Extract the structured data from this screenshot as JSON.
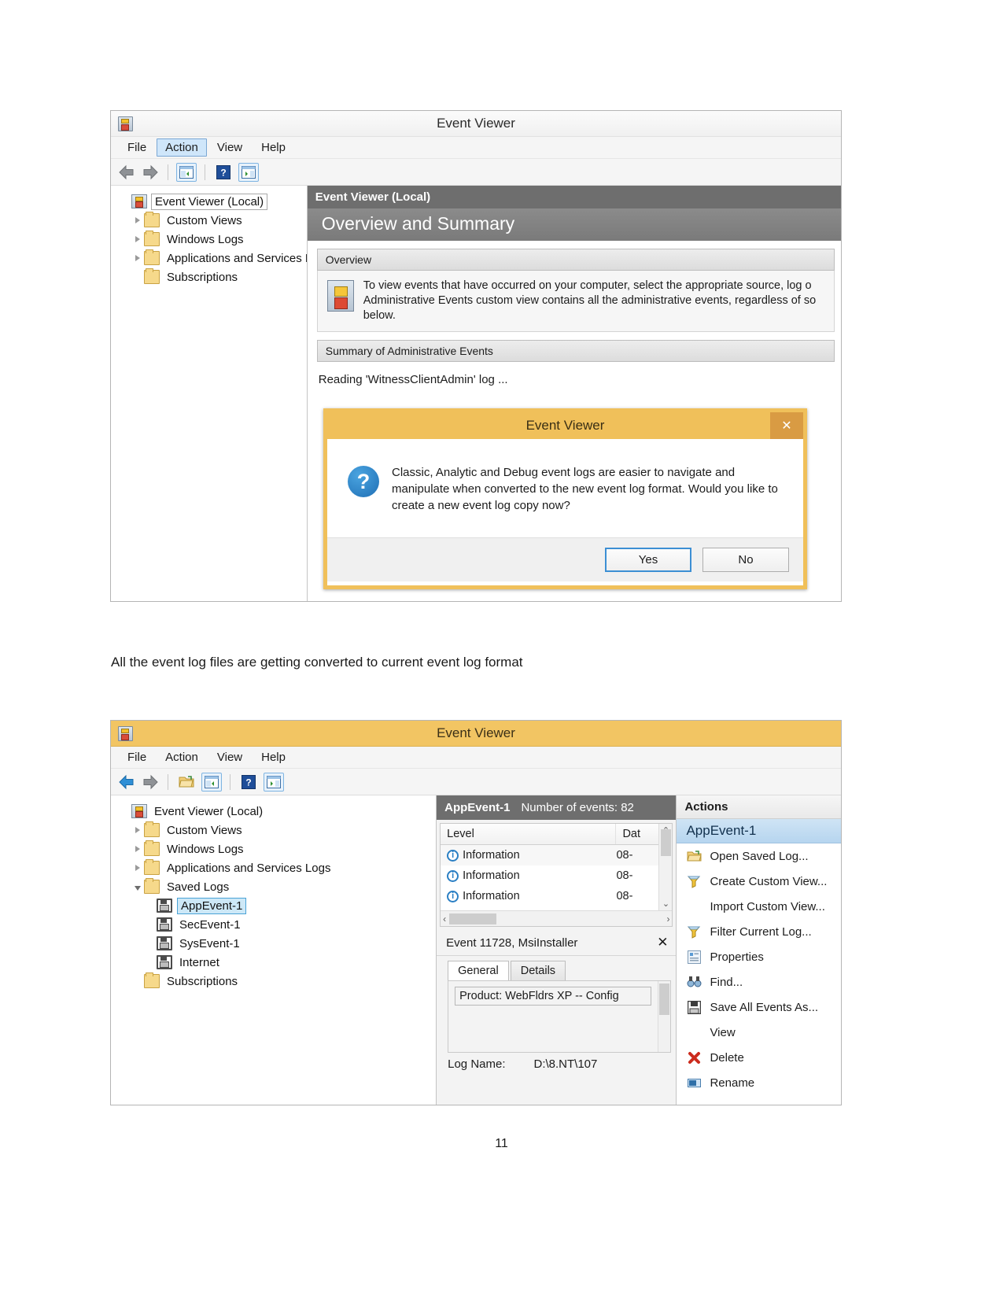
{
  "document": {
    "caption": "All the event log files are getting converted to current event log format",
    "page_number": "11"
  },
  "window1": {
    "title": "Event Viewer",
    "app_icon": "event-viewer-icon",
    "menu": [
      "File",
      "Action",
      "View",
      "Help"
    ],
    "menu_active": "Action",
    "toolbar_icons": [
      "back-arrow-icon",
      "forward-arrow-icon",
      "show-hide-console-tree-icon",
      "help-icon",
      "show-hide-action-pane-icon"
    ],
    "tree": [
      {
        "label": "Event Viewer (Local)",
        "icon": "event-viewer-icon",
        "indent": 0,
        "expander": "none",
        "state": "selected-box"
      },
      {
        "label": "Custom Views",
        "icon": "custom-views-folder-icon",
        "indent": 1,
        "expander": "collapsed",
        "state": "normal"
      },
      {
        "label": "Windows Logs",
        "icon": "windows-logs-folder-icon",
        "indent": 1,
        "expander": "collapsed",
        "state": "normal"
      },
      {
        "label": "Applications and Services Lo",
        "icon": "app-services-folder-icon",
        "indent": 1,
        "expander": "collapsed",
        "state": "normal"
      },
      {
        "label": "Subscriptions",
        "icon": "subscriptions-icon",
        "indent": 1,
        "expander": "none",
        "state": "normal"
      }
    ],
    "pane_header": "Event Viewer (Local)",
    "pane_title": "Overview and Summary",
    "section_overview": "Overview",
    "overview_text": "To view events that have occurred on your computer, select the appropriate source, log o Administrative Events custom view contains all the administrative events, regardless of so below.",
    "section_summary": "Summary of Administrative Events",
    "status_line": "Reading 'WitnessClientAdmin' log ...",
    "dialog": {
      "title": "Event Viewer",
      "close_icon": "close-icon",
      "question_icon": "question-mark-icon",
      "message": "Classic, Analytic and Debug event logs are easier to navigate and manipulate when converted to the new event log format. Would you like to create a new event log copy now?",
      "yes_label": "Yes",
      "no_label": "No"
    }
  },
  "window2": {
    "title": "Event Viewer",
    "app_icon": "event-viewer-icon",
    "menu": [
      "File",
      "Action",
      "View",
      "Help"
    ],
    "toolbar_icons": [
      "back-arrow-icon",
      "forward-arrow-icon",
      "open-saved-log-icon",
      "show-hide-console-tree-icon",
      "help-icon",
      "show-hide-action-pane-icon"
    ],
    "tree": [
      {
        "label": "Event Viewer (Local)",
        "icon": "event-viewer-icon",
        "indent": 0,
        "expander": "none",
        "state": "normal"
      },
      {
        "label": "Custom Views",
        "icon": "custom-views-folder-icon",
        "indent": 1,
        "expander": "collapsed",
        "state": "normal"
      },
      {
        "label": "Windows Logs",
        "icon": "windows-logs-folder-icon",
        "indent": 1,
        "expander": "collapsed",
        "state": "normal"
      },
      {
        "label": "Applications and Services Logs",
        "icon": "app-services-folder-icon",
        "indent": 1,
        "expander": "collapsed",
        "state": "normal"
      },
      {
        "label": "Saved Logs",
        "icon": "saved-logs-folder-icon",
        "indent": 1,
        "expander": "expanded",
        "state": "normal"
      },
      {
        "label": "AppEvent-1",
        "icon": "saved-log-disk-icon",
        "indent": 2,
        "expander": "none",
        "state": "selected-blue"
      },
      {
        "label": "SecEvent-1",
        "icon": "saved-log-disk-icon",
        "indent": 2,
        "expander": "none",
        "state": "normal"
      },
      {
        "label": "SysEvent-1",
        "icon": "saved-log-disk-icon",
        "indent": 2,
        "expander": "none",
        "state": "normal"
      },
      {
        "label": "Internet",
        "icon": "saved-log-disk-icon",
        "indent": 2,
        "expander": "none",
        "state": "normal"
      },
      {
        "label": "Subscriptions",
        "icon": "subscriptions-icon",
        "indent": 1,
        "expander": "none",
        "state": "normal"
      }
    ],
    "list": {
      "log_name": "AppEvent-1",
      "event_count_label": "Number of events: 82",
      "columns": [
        "Level",
        "Dat"
      ],
      "rows": [
        {
          "level": "Information",
          "level_icon": "information-icon",
          "date": "08-"
        },
        {
          "level": "Information",
          "level_icon": "information-icon",
          "date": "08-"
        },
        {
          "level": "Information",
          "level_icon": "information-icon",
          "date": "08-"
        }
      ],
      "scroll_up_icon": "chevron-up-icon",
      "scroll_down_icon": "chevron-down-icon",
      "scroll_left_icon": "chevron-left-icon",
      "scroll_right_icon": "chevron-right-icon"
    },
    "detail": {
      "header": "Event 11728, MsiInstaller",
      "close_icon": "close-icon",
      "tabs": [
        "General",
        "Details"
      ],
      "active_tab": "General",
      "body_text": "Product: WebFldrs XP -- Config",
      "log_name_label": "Log Name:",
      "log_name_value": "D:\\8.NT\\107"
    },
    "actions": {
      "header": "Actions",
      "selected": "AppEvent-1",
      "items": [
        {
          "label": "Open Saved Log...",
          "icon": "open-folder-icon"
        },
        {
          "label": "Create Custom View...",
          "icon": "filter-funnel-icon"
        },
        {
          "label": "Import Custom View...",
          "icon": "none"
        },
        {
          "label": "Filter Current Log...",
          "icon": "filter-funnel-icon"
        },
        {
          "label": "Properties",
          "icon": "properties-icon"
        },
        {
          "label": "Find...",
          "icon": "binoculars-icon"
        },
        {
          "label": "Save All Events As...",
          "icon": "save-disk-icon"
        },
        {
          "label": "View",
          "icon": "none"
        },
        {
          "label": "Delete",
          "icon": "delete-x-icon"
        },
        {
          "label": "Rename",
          "icon": "rename-icon"
        }
      ]
    }
  },
  "colors": {
    "gold_title": "#f2c563",
    "dialog_border": "#f0c05a",
    "pane_header_grey": "#6e6e6e",
    "selection_blue": "#cde8f7",
    "actions_selected": "#b6d5ef"
  }
}
